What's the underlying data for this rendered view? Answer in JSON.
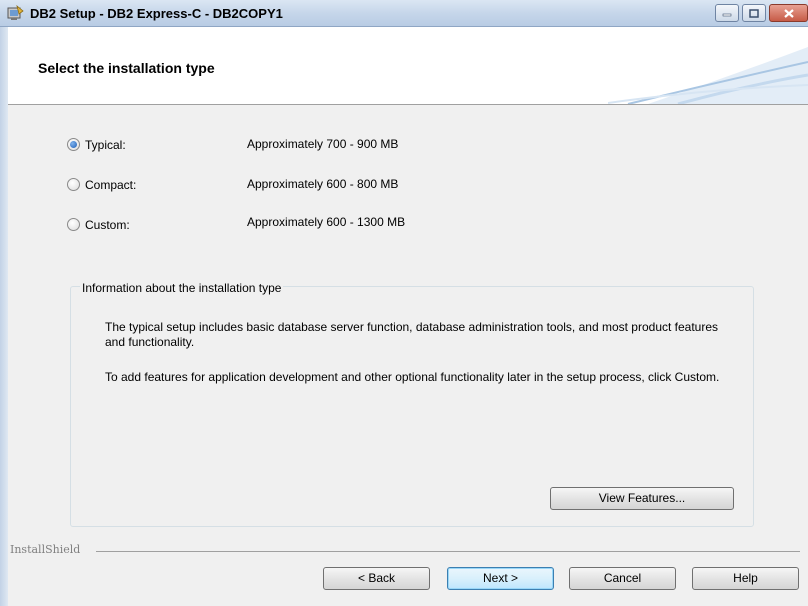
{
  "window": {
    "title": "DB2 Setup - DB2 Express-C - DB2COPY1",
    "controls": [
      "minimize-icon",
      "maximize-icon",
      "close-icon"
    ]
  },
  "header": {
    "title": "Select the installation type"
  },
  "options": [
    {
      "label": "Typical:",
      "size": "Approximately 700 - 900 MB",
      "selected": true
    },
    {
      "label": "Compact:",
      "size": "Approximately 600 - 800 MB",
      "selected": false
    },
    {
      "label": "Custom:",
      "size": "Approximately 600 - 1300 MB",
      "selected": false
    }
  ],
  "info": {
    "legend": "Information about the installation type",
    "paragraph1": "The typical setup includes basic database server function, database administration tools, and most product features and functionality.",
    "paragraph2": "To add features for application development and other optional functionality later in the setup process, click Custom.",
    "view_features_label": "View Features..."
  },
  "footer": {
    "brand": "InstallShield",
    "back_label": "< Back",
    "next_label": "Next >",
    "cancel_label": "Cancel",
    "help_label": "Help"
  },
  "colors": {
    "titlebar": "#c6d6ea",
    "default_button_border": "#3c7fb1",
    "radio_selected": "#1d5fb8"
  }
}
